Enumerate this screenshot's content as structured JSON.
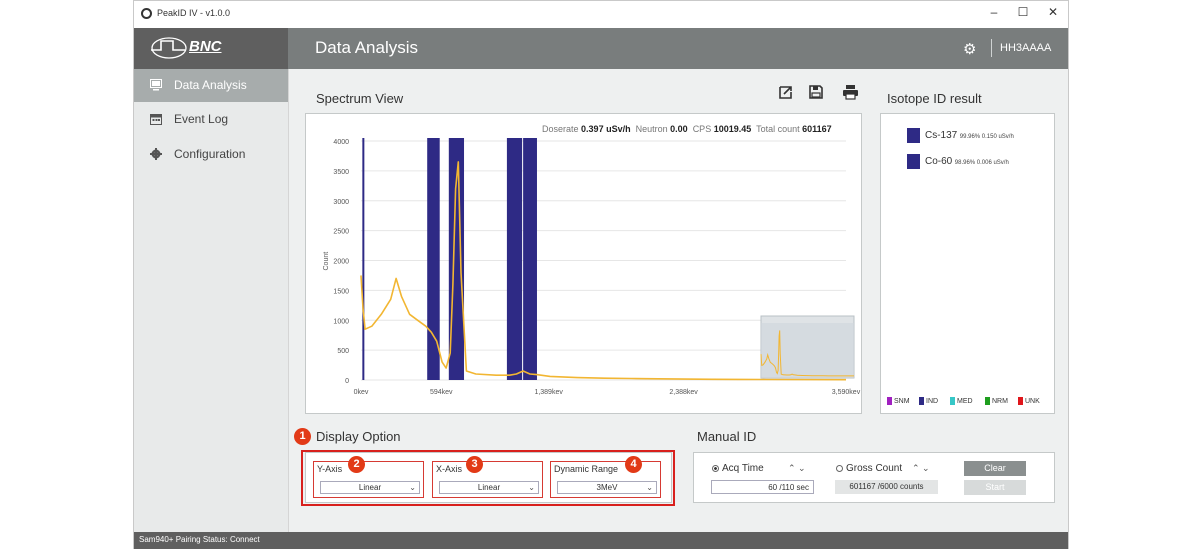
{
  "window": {
    "title": "PeakID IV - v1.0.0",
    "minimize": "–",
    "maximize": "☐",
    "close": "✕"
  },
  "brand": "BNC",
  "sidebar": {
    "items": [
      {
        "label": "Data Analysis",
        "icon": "monitor-icon"
      },
      {
        "label": "Event Log",
        "icon": "calendar-icon"
      },
      {
        "label": "Configuration",
        "icon": "gear-icon"
      }
    ]
  },
  "header": {
    "title": "Data Analysis",
    "device": "HH3AAAA"
  },
  "spectrum": {
    "section_title": "Spectrum View",
    "toolbar": [
      "export-icon",
      "save-icon",
      "print-icon"
    ],
    "info": {
      "doserate_label": "Doserate",
      "doserate_value": "0.397 uSv/h",
      "neutron_label": "Neutron",
      "neutron_value": "0.00",
      "cps_label": "CPS",
      "cps_value": "10019.45",
      "total_label": "Total count",
      "total_value": "601167"
    }
  },
  "chart_data": {
    "type": "line",
    "ylabel": "Count",
    "ylim": [
      0,
      4000
    ],
    "y_ticks": [
      "0",
      "500",
      "1000",
      "1500",
      "2000",
      "2500",
      "3000",
      "3500",
      "4000"
    ],
    "x_ticks": [
      "0kev",
      "594kev",
      "1,389kev",
      "2,388kev",
      "3,590kev"
    ],
    "x_tick_values": [
      0,
      594,
      1389,
      2388,
      3590
    ],
    "xlim": [
      0,
      3590
    ],
    "highlight_bands_kev": [
      [
        10,
        30
      ],
      [
        490,
        590
      ],
      [
        650,
        770
      ],
      [
        1080,
        1200
      ],
      [
        1200,
        1310
      ]
    ],
    "band_color": "#2e2a85",
    "line_color": "#f2b632",
    "series": [
      {
        "x": [
          0,
          15,
          30,
          80,
          150,
          220,
          260,
          300,
          360,
          420,
          480,
          520,
          560,
          600,
          630,
          660,
          680,
          700,
          720,
          740,
          780,
          850,
          1000,
          1100,
          1150,
          1200,
          1250,
          1300,
          1400,
          1600,
          1800,
          2000,
          2200,
          2400,
          2600,
          2800,
          3000,
          3590
        ],
        "y": [
          1750,
          1200,
          850,
          900,
          1100,
          1350,
          1700,
          1400,
          1100,
          1000,
          900,
          800,
          650,
          300,
          200,
          450,
          1600,
          3200,
          3650,
          1800,
          150,
          100,
          80,
          80,
          100,
          150,
          100,
          90,
          60,
          40,
          30,
          25,
          20,
          15,
          12,
          10,
          8,
          5
        ]
      }
    ],
    "minimap": true
  },
  "isotope": {
    "section_title": "Isotope ID result",
    "results": [
      {
        "name": "Cs-137",
        "detail": "99.96% 0.150 uSv/h"
      },
      {
        "name": "Co-60",
        "detail": "98.96% 0.006 uSv/h"
      }
    ],
    "categories": [
      {
        "label": "SNM",
        "color": "#a020c0"
      },
      {
        "label": "IND",
        "color": "#2e2a85"
      },
      {
        "label": "MED",
        "color": "#36c7c7"
      },
      {
        "label": "NRM",
        "color": "#1e9e1e"
      },
      {
        "label": "UNK",
        "color": "#e0161b"
      }
    ]
  },
  "display_option": {
    "badge": "1",
    "title": "Display Option",
    "y_axis": {
      "label": "Y-Axis",
      "badge": "2",
      "value": "Linear"
    },
    "x_axis": {
      "label": "X-Axis",
      "badge": "3",
      "value": "Linear"
    },
    "range": {
      "label": "Dynamic Range",
      "badge": "4",
      "value": "3MeV"
    }
  },
  "manual_id": {
    "title": "Manual ID",
    "acq_label": "Acq Time",
    "acq_value": "60 /110 sec",
    "gross_label": "Gross Count",
    "gross_value": "601167 /6000 counts",
    "clear_label": "Clear",
    "start_label": "Start"
  },
  "status": {
    "text": "Sam940+ Pairing Status:  Connect"
  }
}
